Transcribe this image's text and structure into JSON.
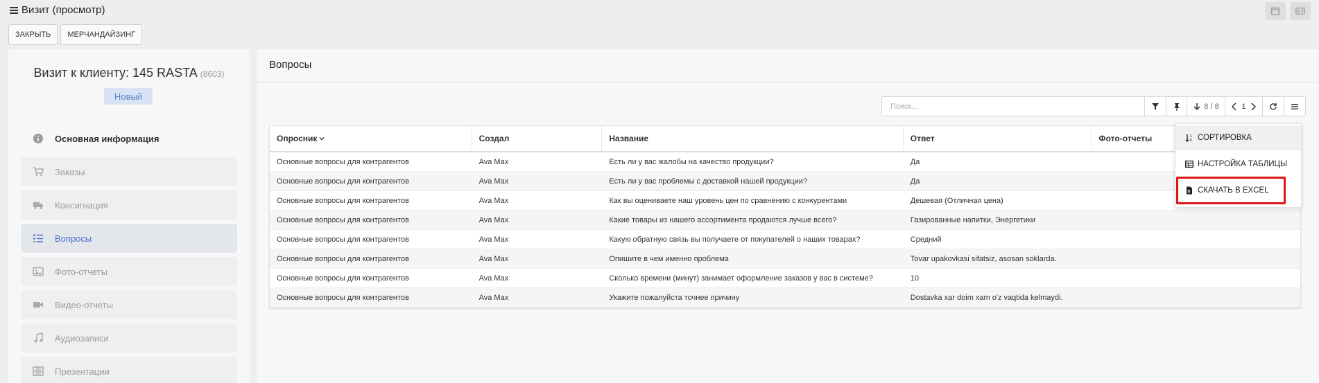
{
  "header": {
    "title": "Визит (просмотр)",
    "icons": [
      "calendar-icon",
      "id-card-icon"
    ]
  },
  "actions": {
    "close_label": "ЗАКРЫТЬ",
    "merch_label": "МЕРЧАНДАЙЗИНГ"
  },
  "visit": {
    "title": "Визит к клиенту: 145 RASTA",
    "code": "(8603)",
    "status": "Новый"
  },
  "sidebar": {
    "items": [
      {
        "label": "Основная информация",
        "icon": "info-icon",
        "state": "header"
      },
      {
        "label": "Заказы",
        "icon": "cart-icon",
        "state": "disabled"
      },
      {
        "label": "Консигнация",
        "icon": "truck-icon",
        "state": "disabled"
      },
      {
        "label": "Вопросы",
        "icon": "checklist-icon",
        "state": "active"
      },
      {
        "label": "Фото-отчеты",
        "icon": "image-icon",
        "state": "disabled"
      },
      {
        "label": "Видео-отчеты",
        "icon": "video-icon",
        "state": "disabled"
      },
      {
        "label": "Аудиозаписи",
        "icon": "music-icon",
        "state": "disabled"
      },
      {
        "label": "Презентации",
        "icon": "film-icon",
        "state": "disabled"
      }
    ]
  },
  "main": {
    "title": "Вопросы",
    "search_placeholder": "Поиск...",
    "toolbar": {
      "count": "8 / 8",
      "page": "1"
    },
    "table": {
      "columns": [
        "Опросник",
        "Создал",
        "Название",
        "Ответ",
        "Фото-отчеты"
      ],
      "rows": [
        [
          "Основные вопросы для контрагентов",
          "Ava Max",
          "Есть ли у вас жалобы на качество продукции?",
          "Да",
          ""
        ],
        [
          "Основные вопросы для контрагентов",
          "Ava Max",
          "Есть ли у вас проблемы с доставкой нашей продукции?",
          "Да",
          ""
        ],
        [
          "Основные вопросы для контрагентов",
          "Ava Max",
          "Как вы оцениваете наш уровень цен по сравнению с конкурентами",
          "Дешевая (Отличная цена)",
          ""
        ],
        [
          "Основные вопросы для контрагентов",
          "Ava Max",
          "Какие товары из нашего ассортимента продаются лучше всего?",
          "Газированные напитки, Энергетики",
          ""
        ],
        [
          "Основные вопросы для контрагентов",
          "Ava Max",
          "Какую обратную связь вы получаете от покупателей о наших товарах?",
          "Средний",
          ""
        ],
        [
          "Основные вопросы для контрагентов",
          "Ava Max",
          "Опишите в чем именно проблема",
          "Tovar upakovkasi sifatsiz, asosan soklarda.",
          ""
        ],
        [
          "Основные вопросы для контрагентов",
          "Ava Max",
          "Сколько времени (минут) занимает оформление заказов у вас в системе?",
          "10",
          ""
        ],
        [
          "Основные вопросы для контрагентов",
          "Ava Max",
          "Укажите пожалуйста точнее причину",
          "Dostavka xar doim xam o'z vaqtida kelmaydi.",
          ""
        ]
      ]
    },
    "menu": {
      "items": [
        {
          "label": "СОРТИРОВКА",
          "icon": "sort-icon"
        },
        {
          "label": "НАСТРОЙКА ТАБЛИЦЫ",
          "icon": "table-icon"
        },
        {
          "label": "СКАЧАТЬ В EXCEL",
          "icon": "excel-file-icon"
        }
      ]
    }
  },
  "colors": {
    "accent": "#4b6ecf",
    "highlight": "#e01414",
    "badge_bg": "#d8e4f6"
  }
}
